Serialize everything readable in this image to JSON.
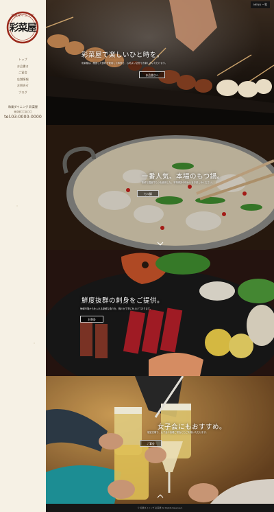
{
  "logo": {
    "tagline": "和風ダイニング",
    "name": "彩菜屋"
  },
  "nav": [
    "トップ",
    "お品書き",
    "ご宴会",
    "店舗情報",
    "お問合せ",
    "ブログ"
  ],
  "store": {
    "name": "和風ダイニング 彩菜屋",
    "sub": "東京都〇〇区〇〇",
    "phone": "tel.03-0000-0000"
  },
  "menu_button": "MENU 一覧",
  "sections": [
    {
      "title": "彩菜屋で楽しいひと時を。",
      "text": "彩菜屋は、厳選した食材を使用した和食を、心地よい空間でお楽しみいただけます。",
      "button": "お品書きへ"
    },
    {
      "title": "一番人気、本場のもつ鍋。",
      "text": "新鮮な国産牛もつを使用した、本場博多の味わいをお楽しみください。",
      "button": "もつ鍋"
    },
    {
      "title": "鮮度抜群の刺身をご提供。",
      "text": "毎朝市場から仕入れる新鮮な魚介を、職人が丁寧に仕上げております。",
      "button": "お刺身"
    },
    {
      "title": "女子会にもおすすめ。",
      "text": "個室完備で、女子会や各種ご宴会にもご利用いただけます。",
      "button": "ご宴会"
    }
  ],
  "footer": "© 和風ダイニング 彩菜屋 All Rights Reserved."
}
